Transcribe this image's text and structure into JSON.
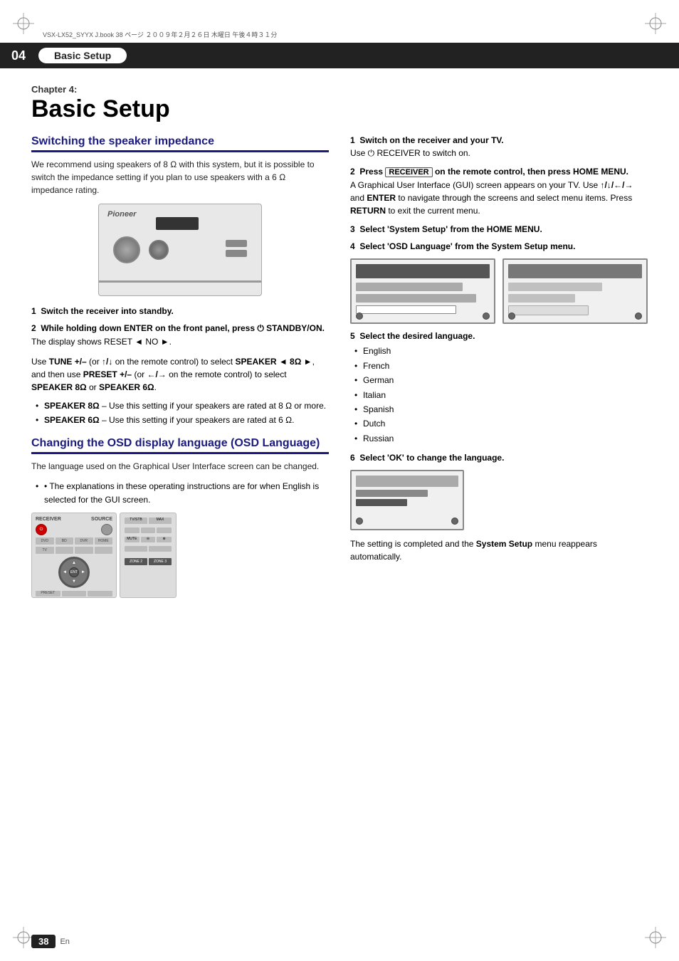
{
  "file_line": "VSX-LX52_SYYX J.book   38 ページ   ２００９年２月２６日   木曜日   午後４時３１分",
  "header": {
    "chapter_num": "04",
    "title": "Basic Setup"
  },
  "chapter": {
    "label": "Chapter 4:",
    "title": "Basic Setup"
  },
  "section1": {
    "heading": "Switching the speaker impedance",
    "intro": "We recommend using speakers of 8 Ω with this system, but it is possible to switch the impedance setting if you plan to use speakers with a 6 Ω impedance rating.",
    "steps": [
      {
        "num": "1",
        "title": "Switch the receiver into standby."
      },
      {
        "num": "2",
        "title": "While holding down ENTER on the front panel, press ⏻ STANDBY/ON.",
        "body": "The display shows RESET ◄ NO ►."
      }
    ],
    "tune_text": "Use TUNE +/– (or ↑/↓ on the remote control) to select SPEAKER ◄ 8Ω ►, and then use PRESET +/– (or ←/→ on the remote control) to select SPEAKER 8Ω or SPEAKER 6Ω.",
    "bullets": [
      {
        "label": "SPEAKER 8Ω",
        "text": "– Use this setting if your speakers are rated at 8 Ω or more."
      },
      {
        "label": "SPEAKER 6Ω",
        "text": "– Use this setting if your speakers are rated at 6 Ω."
      }
    ]
  },
  "section2": {
    "heading": "Changing the OSD display language (OSD Language)",
    "intro": "The language used on the Graphical User Interface screen can be changed.",
    "note": "• The explanations in these operating instructions are for when English is selected for the GUI screen."
  },
  "section3": {
    "steps": [
      {
        "num": "1",
        "title": "Switch on the receiver and your TV.",
        "body": "Use ⏻ RECEIVER to switch on."
      },
      {
        "num": "2",
        "title": "Press RECEIVER on the remote control, then press HOME MENU.",
        "body": "A Graphical User Interface (GUI) screen appears on your TV. Use ↑/↓/←/→ and ENTER to navigate through the screens and select menu items. Press RETURN to exit the current menu."
      },
      {
        "num": "3",
        "title": "Select 'System Setup' from the HOME MENU."
      },
      {
        "num": "4",
        "title": "Select 'OSD Language' from the System Setup menu."
      },
      {
        "num": "5",
        "title": "Select the desired language.",
        "languages": [
          "English",
          "French",
          "German",
          "Italian",
          "Spanish",
          "Dutch",
          "Russian"
        ]
      },
      {
        "num": "6",
        "title": "Select 'OK' to change the language."
      }
    ],
    "closing_text": "The setting is completed and the System Setup menu reappears automatically."
  },
  "footer": {
    "page_num": "38",
    "lang": "En"
  }
}
